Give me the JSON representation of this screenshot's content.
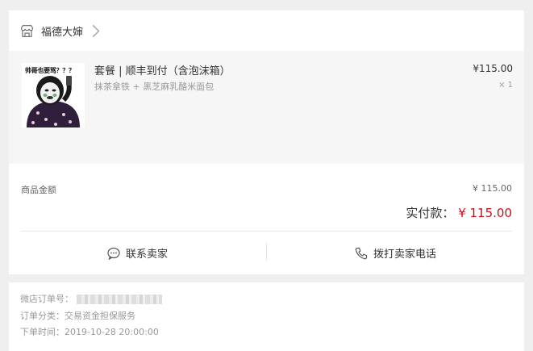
{
  "shop": {
    "name": "福德大婶"
  },
  "product": {
    "thumbnail_caption": "帅哥也要骂？？？",
    "title": "套餐 | 顺丰到付（含泡沫箱）",
    "variant": "抹茶拿铁 + 黑芝麻乳酪米面包",
    "price": "¥115.00",
    "quantity": "× 1"
  },
  "summary": {
    "goods_label": "商品金额",
    "goods_amount": "¥ 115.00",
    "paid_label": "实付款：",
    "paid_amount": "¥ 115.00"
  },
  "actions": {
    "contact_label": "联系卖家",
    "call_label": "拨打卖家电话"
  },
  "order_info": {
    "order_no_label": "微店订单号：",
    "category_label": "订单分类：",
    "category_value": "交易资金担保服务",
    "time_label": "下单时间：",
    "time_value": "2019-10-28 20:00:00"
  },
  "colors": {
    "accent": "#c4121a",
    "page_bg": "#efefef",
    "product_bg": "#f6f6f6"
  }
}
